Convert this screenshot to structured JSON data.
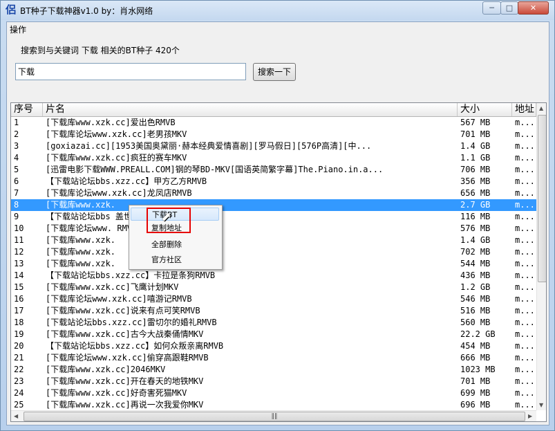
{
  "window": {
    "title": "BT种子下载神器v1.0  by：肖水网络",
    "icon": "app-icon-glyph",
    "min_icon": "minimize-icon",
    "max_icon": "maximize-icon",
    "close_icon": "close-icon"
  },
  "menu": {
    "operate": "操作"
  },
  "info": {
    "text": "搜索到与关键词  下载  相关的BT种子 420个"
  },
  "search": {
    "value": "下载",
    "button": "搜索一下"
  },
  "table": {
    "headers": [
      "序号",
      "片名",
      "大小",
      "地址"
    ],
    "rows": [
      [
        "1",
        "[下载库www.xzk.cc]爱出色RMVB",
        "567 MB",
        "m..."
      ],
      [
        "2",
        "[下载库论坛www.xzk.cc]老男孩MKV",
        "701 MB",
        "m..."
      ],
      [
        "3",
        "[goxiazai.cc][1953美国奥黛丽·赫本经典爱情喜剧][罗马假日][576P高清][中...",
        "1.4 GB",
        "m..."
      ],
      [
        "4",
        "[下载库www.xzk.cc]疯狂的赛车MKV",
        "1.1 GB",
        "m..."
      ],
      [
        "5",
        "[迅雷电影下载WWW.PREALL.COM]钢的琴BD-MKV[国语英简繁字幕]The.Piano.in.a...",
        "706 MB",
        "m..."
      ],
      [
        "6",
        "【下载站论坛bbs.xzz.cc】甲方乙方RMVB",
        "356 MB",
        "m..."
      ],
      [
        "7",
        "[下载库论坛www.xzk.cc]龙凤店RMVB",
        "656 MB",
        "m..."
      ],
      [
        "8",
        "[下载库www.xzk.",
        "2.7 GB",
        "m..."
      ],
      [
        "9",
        "【下载站论坛bbs              盖世五侠的秘密RMVB",
        "116 MB",
        "m..."
      ],
      [
        "10",
        "[下载库论坛www.              RMVB",
        "576 MB",
        "m..."
      ],
      [
        "11",
        "[下载库www.xzk.",
        "1.4 GB",
        "m..."
      ],
      [
        "12",
        "[下载库www.xzk.",
        "702 MB",
        "m..."
      ],
      [
        "13",
        "[下载库www.xzk.",
        "544 MB",
        "m..."
      ],
      [
        "14",
        "【下载站论坛bbs.xzz.cc】卡拉是条狗RMVB",
        "436 MB",
        "m..."
      ],
      [
        "15",
        "[下载库www.xzk.cc]飞鹰计划MKV",
        "1.2 GB",
        "m..."
      ],
      [
        "16",
        "[下载库论坛www.xzk.cc]嘻游记RMVB",
        "546 MB",
        "m..."
      ],
      [
        "17",
        "[下载库www.xzk.cc]说来有点可笑RMVB",
        "516 MB",
        "m..."
      ],
      [
        "18",
        "[下载站论坛bbs.xzz.cc]雷切尔的婚礼RMVB",
        "560 MB",
        "m..."
      ],
      [
        "19",
        "[下载库www.xzk.cc]古今大战秦俑情MKV",
        "22.2 GB",
        "m..."
      ],
      [
        "20",
        "【下载站论坛bbs.xzz.cc】如何众叛亲离RMVB",
        "454 MB",
        "m..."
      ],
      [
        "21",
        "[下载库论坛www.xzk.cc]偷穿高跟鞋RMVB",
        "666 MB",
        "m..."
      ],
      [
        "22",
        "[下载库www.xzk.cc]2046MKV",
        "1023 MB",
        "m..."
      ],
      [
        "23",
        "[下载库www.xzk.cc]开在春天的地铁MKV",
        "701 MB",
        "m..."
      ],
      [
        "24",
        "[下载库www.xzk.cc]好奇害死猫MKV",
        "699 MB",
        "m..."
      ],
      [
        "25",
        "[下载库www.xzk.cc]再说一次我爱你MKV",
        "696 MB",
        "m..."
      ]
    ]
  },
  "context_menu": {
    "items": [
      "下载BT",
      "复制地址",
      "全部删除",
      "官方社区"
    ]
  },
  "colors": {
    "selection": "#3399ff",
    "highlight_box": "#e60000"
  }
}
